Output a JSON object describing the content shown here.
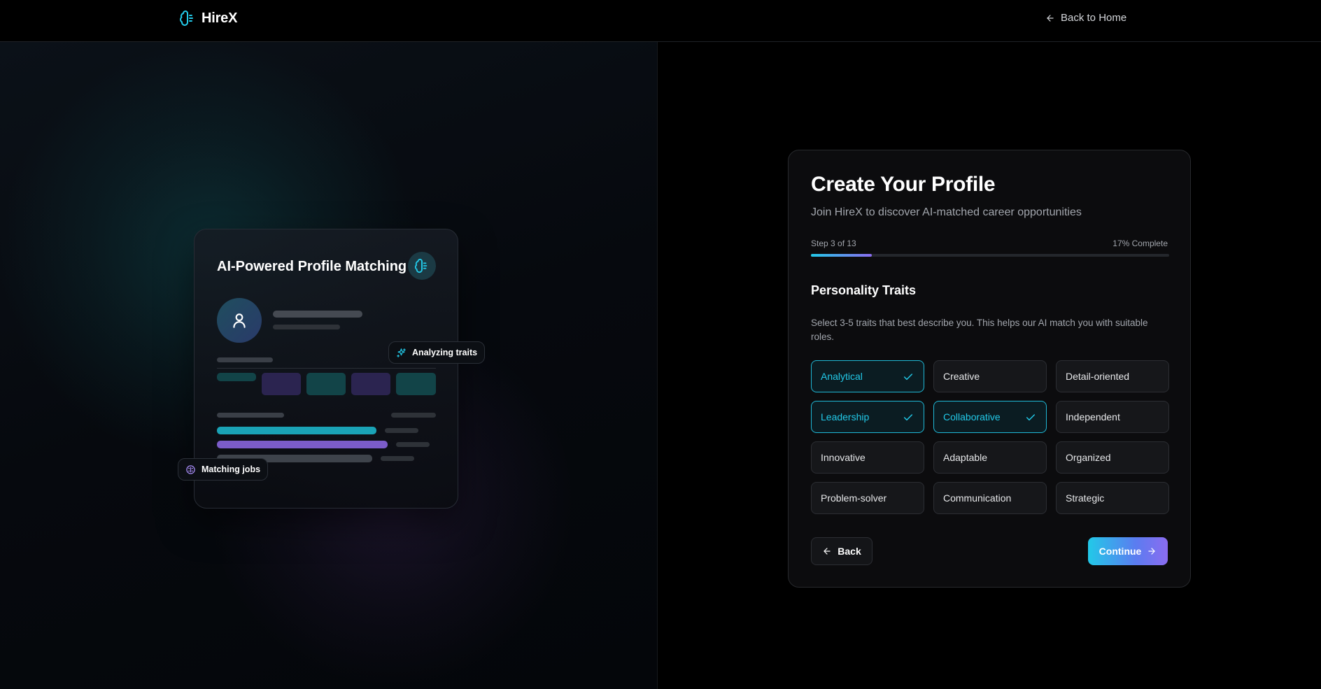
{
  "header": {
    "brand": "HireX",
    "back_home": "Back to Home"
  },
  "preview": {
    "title": "AI-Powered Profile Matching",
    "analyzing_pill": "Analyzing traits",
    "matching_pill": "Matching jobs"
  },
  "form": {
    "title": "Create Your Profile",
    "subtitle": "Join HireX to discover AI-matched career opportunities",
    "step_label": "Step 3 of 13",
    "progress_label": "17% Complete",
    "progress_fraction": 0.17,
    "section_title": "Personality Traits",
    "section_desc": "Select 3-5 traits that best describe you. This helps our AI match you with suitable roles.",
    "traits": [
      {
        "label": "Analytical",
        "selected": true
      },
      {
        "label": "Creative",
        "selected": false
      },
      {
        "label": "Detail-oriented",
        "selected": false
      },
      {
        "label": "Leadership",
        "selected": true
      },
      {
        "label": "Collaborative",
        "selected": true
      },
      {
        "label": "Independent",
        "selected": false
      },
      {
        "label": "Innovative",
        "selected": false
      },
      {
        "label": "Adaptable",
        "selected": false
      },
      {
        "label": "Organized",
        "selected": false
      },
      {
        "label": "Problem-solver",
        "selected": false
      },
      {
        "label": "Communication",
        "selected": false
      },
      {
        "label": "Strategic",
        "selected": false
      }
    ],
    "back_label": "Back",
    "continue_label": "Continue"
  },
  "colors": {
    "accent_cyan": "#22c9e8",
    "accent_purple": "#8b6cf0",
    "background": "#000000",
    "card": "#0c0c0e"
  },
  "icons": [
    "brain-logo-icon",
    "arrow-left-icon",
    "sparkles-icon",
    "user-icon",
    "cpu-icon",
    "check-icon",
    "arrow-right-icon"
  ]
}
